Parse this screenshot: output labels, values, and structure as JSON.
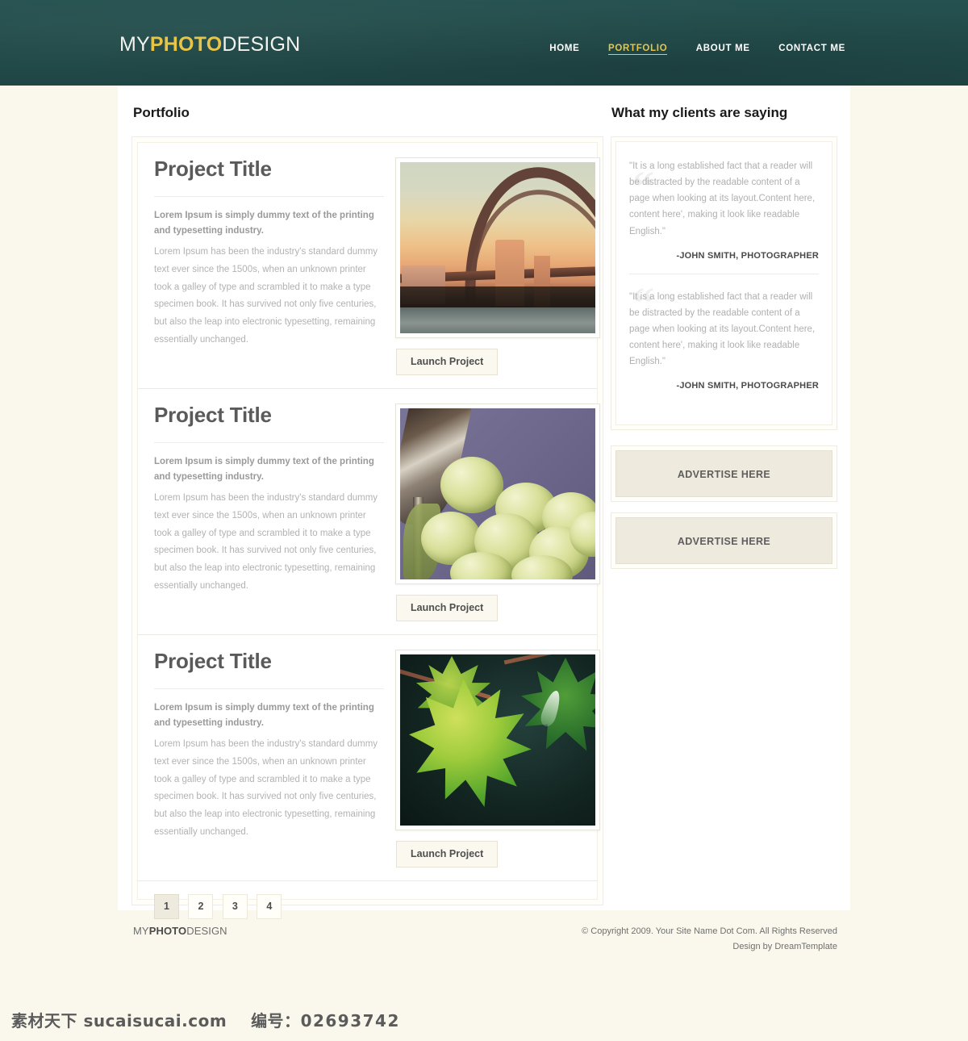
{
  "site": {
    "logo": {
      "part1": "MY",
      "part2": "PHOTO",
      "part3": "DESIGN"
    },
    "accent_color": "#e8c547",
    "header_color": "#234d4c",
    "page_background": "#faf8ec"
  },
  "nav": {
    "items": [
      {
        "label": "HOME",
        "active": false
      },
      {
        "label": "PORTFOLIO",
        "active": true
      },
      {
        "label": "ABOUT ME",
        "active": false
      },
      {
        "label": "CONTACT ME",
        "active": false
      }
    ]
  },
  "main": {
    "section_title": "Portfolio",
    "projects": [
      {
        "title": "Project Title",
        "lead": "Lorem Ipsum is simply dummy text of the printing and typesetting industry.",
        "body": "Lorem Ipsum has been the industry's standard dummy text ever since the 1500s, when an unknown printer took a galley of type and scrambled it to make a type specimen book. It has survived not only five centuries, but also the leap into electronic typesetting, remaining essentially unchanged.",
        "button_label": "Launch Project",
        "image_name": "sydney-harbour-bridge-sunset"
      },
      {
        "title": "Project Title",
        "lead": "Lorem Ipsum is simply dummy text of the printing and typesetting industry.",
        "body": "Lorem Ipsum has been the industry's standard dummy text ever since the 1500s, when an unknown printer took a galley of type and scrambled it to make a type specimen book. It has survived not only five centuries, but also the leap into electronic typesetting, remaining essentially unchanged.",
        "button_label": "Launch Project",
        "image_name": "white-grapes-and-wine-glass"
      },
      {
        "title": "Project Title",
        "lead": "Lorem Ipsum is simply dummy text of the printing and typesetting industry.",
        "body": "Lorem Ipsum has been the industry's standard dummy text ever since the 1500s, when an unknown printer took a galley of type and scrambled it to make a type specimen book. It has survived not only five centuries, but also the leap into electronic typesetting, remaining essentially unchanged.",
        "button_label": "Launch Project",
        "image_name": "backlit-maple-leaf"
      }
    ],
    "pagination": [
      {
        "label": "1",
        "active": true
      },
      {
        "label": "2",
        "active": false
      },
      {
        "label": "3",
        "active": false
      },
      {
        "label": "4",
        "active": false
      }
    ]
  },
  "sidebar": {
    "section_title": "What my clients are saying",
    "testimonials": [
      {
        "text": "\"It is a long established fact that a reader will be distracted by the readable content of a page when looking at its layout.Content here, content here', making it look like readable English.\"",
        "author": "-JOHN SMITH, PHOTOGRAPHER",
        "quote_mark": "“"
      },
      {
        "text": "\"It is a long established fact that a reader will be distracted by the readable content of a page when looking at its layout.Content here, content here', making it look like readable English.\"",
        "author": "-JOHN SMITH, PHOTOGRAPHER",
        "quote_mark": "“"
      }
    ],
    "ads": [
      {
        "label": "ADVERTISE HERE"
      },
      {
        "label": "ADVERTISE HERE"
      }
    ]
  },
  "footer": {
    "logo": {
      "part1": "MY",
      "part2": "PHOTO",
      "part3": "DESIGN"
    },
    "copyright": "© Copyright 2009. Your Site Name Dot Com. All Rights Reserved",
    "credit": "Design by DreamTemplate"
  },
  "watermark": {
    "site": "素材天下 sucaisucai.com",
    "label": "编号：",
    "number": "02693742"
  }
}
